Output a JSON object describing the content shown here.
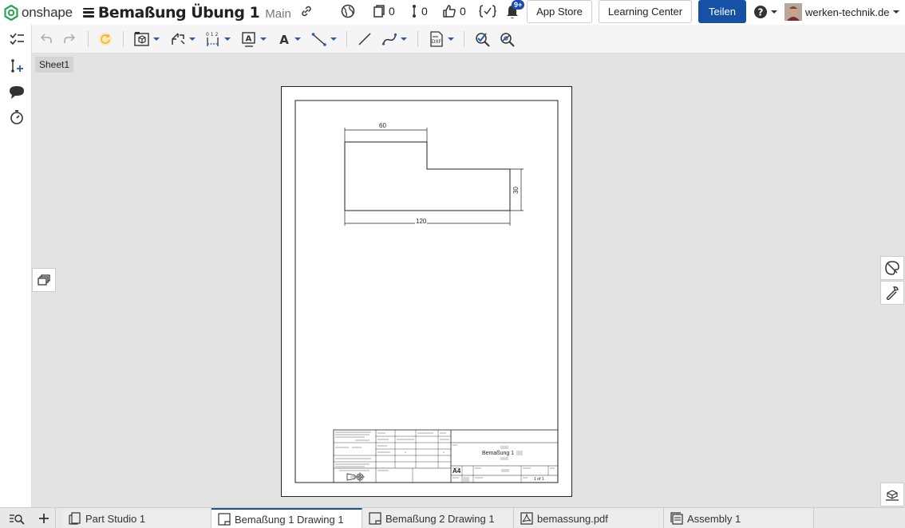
{
  "app": {
    "name": "onshape"
  },
  "document": {
    "title": "Bemaßung Übung 1",
    "branch": "Main"
  },
  "header": {
    "versions_count": "0",
    "branches_count": "0",
    "likes_count": "0",
    "notifications_badge": "9+",
    "app_store_label": "App Store",
    "learning_center_label": "Learning Center",
    "share_label": "Teilen",
    "user_name": "werken-technik.de"
  },
  "sheet": {
    "name": "Sheet1"
  },
  "drawing": {
    "dim_top": "60",
    "dim_right": "30",
    "dim_bottom": "120",
    "title_block_name": "Bemaßung 1",
    "title_block_size": "A4",
    "title_block_sheet": "1 of 1"
  },
  "tabs": [
    {
      "label": "Part Studio 1"
    },
    {
      "label": "Bemaßung 1 Drawing 1"
    },
    {
      "label": "Bemaßung 2 Drawing 1"
    },
    {
      "label": "bemassung.pdf"
    },
    {
      "label": "Assembly 1"
    }
  ],
  "colors": {
    "accent": "#1552a6",
    "logo": "#2f9e5a",
    "highlight": "#e8b43a"
  }
}
